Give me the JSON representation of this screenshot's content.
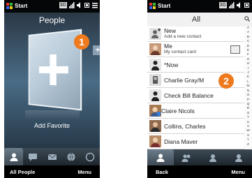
{
  "left_phone": {
    "status": {
      "start": "Start",
      "net": "3G"
    },
    "title": "People",
    "add_favorite": "Add Favorite",
    "plus_glyph": "+",
    "callout": "1",
    "softkeys": {
      "left": "All People",
      "right": "Menu"
    },
    "tabs": [
      "people-icon",
      "message-icon",
      "mail-icon",
      "globe-icon",
      "web-icon"
    ]
  },
  "right_phone": {
    "status": {
      "start": "Start",
      "net": "3G"
    },
    "title": "All",
    "callout": "2",
    "contacts": [
      {
        "name": "New",
        "sub": "Add a new contact"
      },
      {
        "name": "Me",
        "sub": "My contact card"
      },
      {
        "name": "*Now",
        "sub": ""
      },
      {
        "name": "Charlie Gray/M",
        "sub": ""
      },
      {
        "name": "Check Bill Balance",
        "sub": ""
      },
      {
        "name": "Claire Nicols",
        "sub": ""
      },
      {
        "name": "Collins, Charles",
        "sub": ""
      },
      {
        "name": "Diana Maver",
        "sub": ""
      }
    ],
    "alphabet": [
      "#",
      "A",
      "B",
      "C",
      "D",
      "E",
      "F",
      "G",
      "H",
      "I",
      "J",
      "K",
      "L",
      "M",
      "N",
      "O",
      "P",
      "Q",
      "R",
      "S",
      "T",
      "U",
      "V",
      "W",
      "X",
      "Y",
      "Z"
    ],
    "softkeys": {
      "left": "Back",
      "right": "Menu"
    }
  }
}
